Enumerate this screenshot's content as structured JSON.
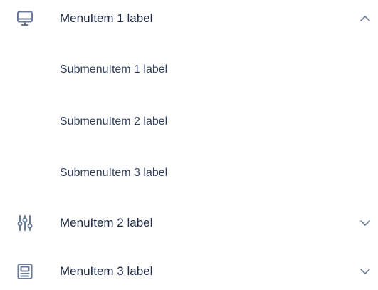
{
  "menu": {
    "items": [
      {
        "label": "MenuItem 1 label",
        "icon": "monitor-icon",
        "expanded": true,
        "submenu": [
          {
            "label": "SubmenuItem 1 label"
          },
          {
            "label": "SubmenuItem 2 label"
          },
          {
            "label": "SubmenuItem 3 label"
          }
        ]
      },
      {
        "label": "MenuItem 2 label",
        "icon": "sliders-icon",
        "expanded": false
      },
      {
        "label": "MenuItem 3 label",
        "icon": "newspaper-icon",
        "expanded": false
      }
    ]
  },
  "colors": {
    "icon": "#6b7a99",
    "text": "#1f2a44",
    "subtext": "#33415c",
    "chevron": "#6b7a99"
  }
}
